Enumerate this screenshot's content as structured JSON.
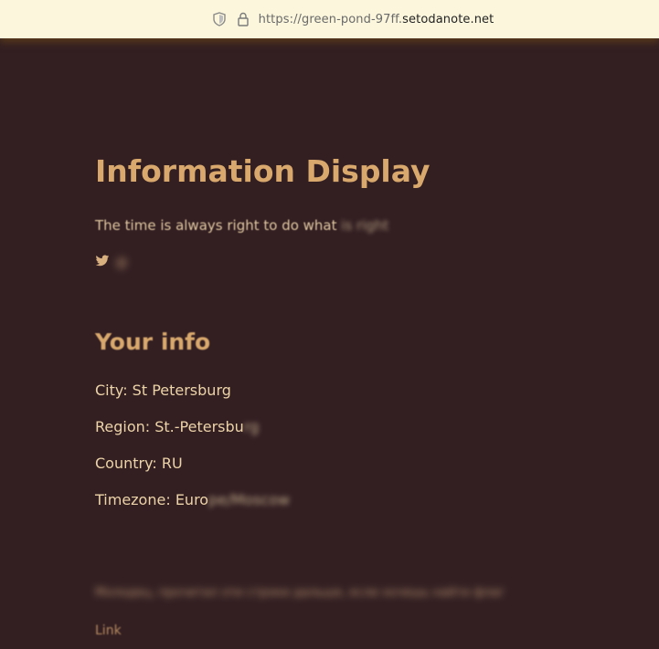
{
  "browser": {
    "url_prefix": "https://green-pond-97ff.",
    "url_domain": "setodanote.net"
  },
  "page": {
    "title": "Information Display",
    "tagline_main": "The time is always right to do what ",
    "tagline_faded": "is right",
    "twitter_handle": "@",
    "info_heading": "Your info",
    "city_label": "City: ",
    "city_value": "St Petersburg",
    "region_label": "Region: ",
    "region_value": "St.-Petersbu",
    "region_blur": "rg",
    "country_label": "Country: ",
    "country_value": "RU",
    "timezone_label": "Timezone: ",
    "timezone_value": "Euro",
    "timezone_blur": "pe/Moscow",
    "footer_text": "Молодец, прочитал эти строки дальше, если хочешь найти флаг",
    "link_label": "Link"
  },
  "colors": {
    "background": "#331f22",
    "accent": "#d8a86c",
    "text": "#ecd3a8"
  }
}
